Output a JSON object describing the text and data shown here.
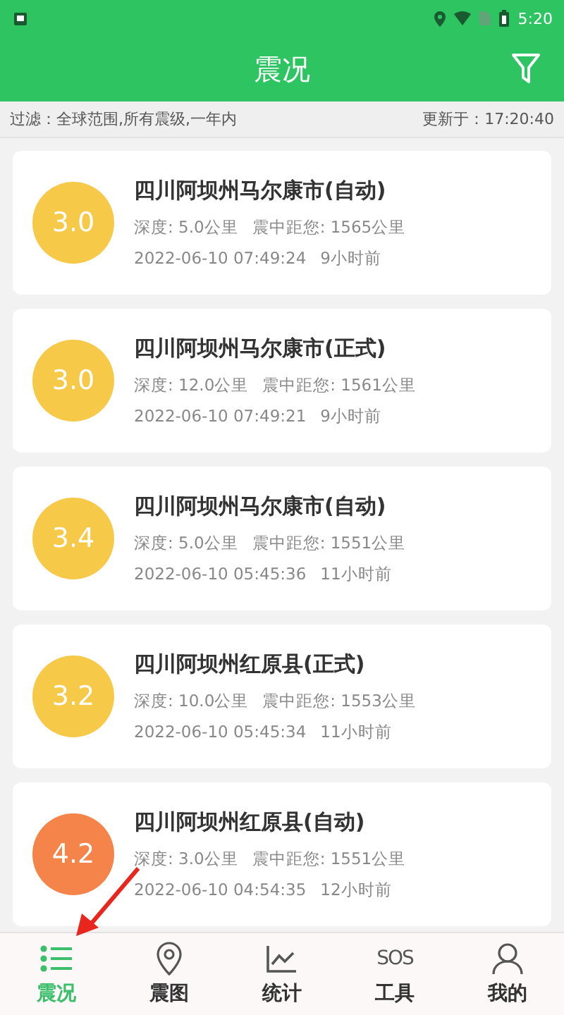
{
  "status_bar": {
    "time": "5:20"
  },
  "app_bar": {
    "title": "震况"
  },
  "filter_bar": {
    "filter": "过滤：全球范围,所有震级,一年内",
    "updated": "更新于：17:20:40"
  },
  "quakes": [
    {
      "magnitude": "3.0",
      "color": "#f7c948",
      "place": "四川阿坝州马尔康市(自动)",
      "depth": "深度: 5.0公里",
      "distance": "震中距您: 1565公里",
      "time": "2022-06-10 07:49:24",
      "ago": "9小时前"
    },
    {
      "magnitude": "3.0",
      "color": "#f7c948",
      "place": "四川阿坝州马尔康市(正式)",
      "depth": "深度: 12.0公里",
      "distance": "震中距您: 1561公里",
      "time": "2022-06-10 07:49:21",
      "ago": "9小时前"
    },
    {
      "magnitude": "3.4",
      "color": "#f7c948",
      "place": "四川阿坝州马尔康市(自动)",
      "depth": "深度: 5.0公里",
      "distance": "震中距您: 1551公里",
      "time": "2022-06-10 05:45:36",
      "ago": "11小时前"
    },
    {
      "magnitude": "3.2",
      "color": "#f7c948",
      "place": "四川阿坝州红原县(正式)",
      "depth": "深度: 10.0公里",
      "distance": "震中距您: 1553公里",
      "time": "2022-06-10 05:45:34",
      "ago": "11小时前"
    },
    {
      "magnitude": "4.2",
      "color": "#f5844a",
      "place": "四川阿坝州红原县(自动)",
      "depth": "深度: 3.0公里",
      "distance": "震中距您: 1551公里",
      "time": "2022-06-10 04:54:35",
      "ago": "12小时前"
    }
  ],
  "tabs": [
    {
      "label": "震况",
      "selected": true
    },
    {
      "label": "震图",
      "selected": false
    },
    {
      "label": "统计",
      "selected": false
    },
    {
      "label": "工具",
      "selected": false,
      "icon_text": "SOS"
    },
    {
      "label": "我的",
      "selected": false
    }
  ]
}
